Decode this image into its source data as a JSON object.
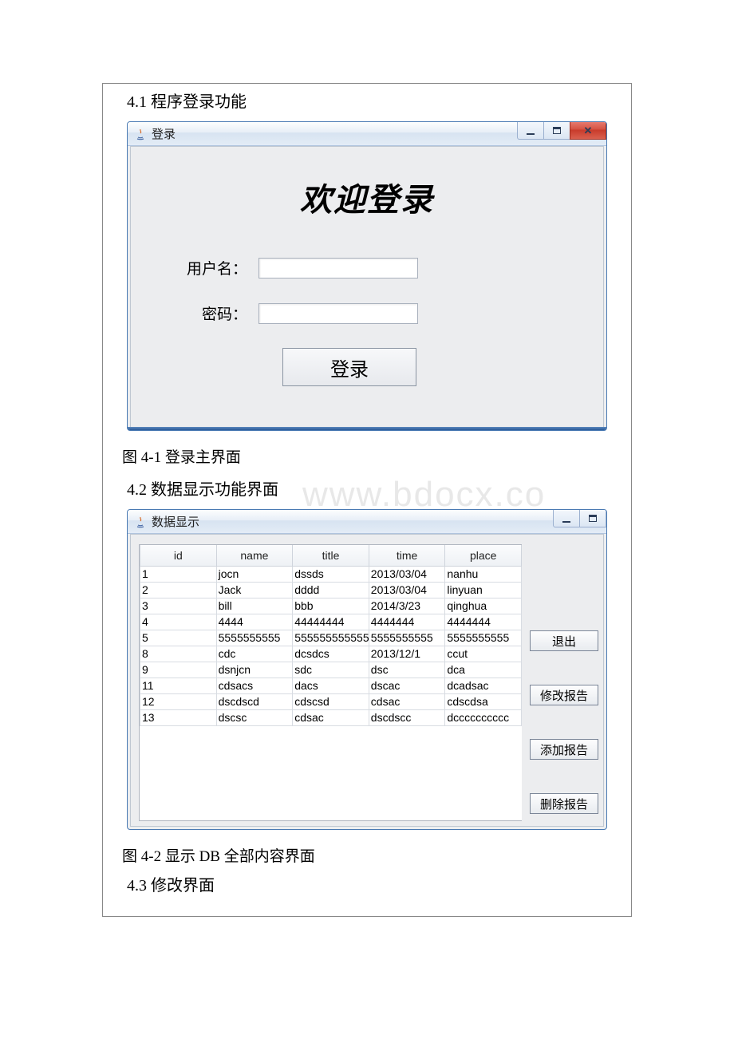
{
  "section1_heading": "4.1 程序登录功能",
  "caption1": "图 4-1 登录主界面",
  "section2_heading": "4.2 数据显示功能界面",
  "caption2": "图 4-2 显示 DB 全部内容界面",
  "section3_heading": "4.3 修改界面",
  "watermark": "www.bdocx.co",
  "login_window": {
    "title": "登录",
    "heading": "欢迎登录",
    "username_label": "用户名：",
    "password_label": "密码：",
    "submit_label": "登录"
  },
  "data_window": {
    "title": "数据显示",
    "columns": [
      "id",
      "name",
      "title",
      "time",
      "place"
    ],
    "rows": [
      [
        "1",
        "jocn",
        "dssds",
        "2013/03/04",
        "nanhu"
      ],
      [
        "2",
        "Jack",
        "dddd",
        "2013/03/04",
        "linyuan"
      ],
      [
        "3",
        "bill",
        "bbb",
        "2014/3/23",
        "qinghua"
      ],
      [
        "4",
        "4444",
        "44444444",
        "4444444",
        "4444444"
      ],
      [
        "5",
        "5555555555",
        "5555555555555",
        "5555555555",
        "5555555555"
      ],
      [
        "8",
        "cdc",
        "dcsdcs",
        "2013/12/1",
        "ccut"
      ],
      [
        "9",
        "dsnjcn",
        "sdc",
        "dsc",
        "dca"
      ],
      [
        "11",
        "cdsacs",
        "dacs",
        "dscac",
        "dcadsac"
      ],
      [
        "12",
        "dscdscd",
        "cdscsd",
        "cdsac",
        "cdscdsa"
      ],
      [
        "13",
        "dscsc",
        "cdsac",
        "dscdscc",
        "dcccccccccc"
      ]
    ],
    "buttons": {
      "exit": "退出",
      "modify": "修改报告",
      "add": "添加报告",
      "delete": "删除报告"
    }
  }
}
